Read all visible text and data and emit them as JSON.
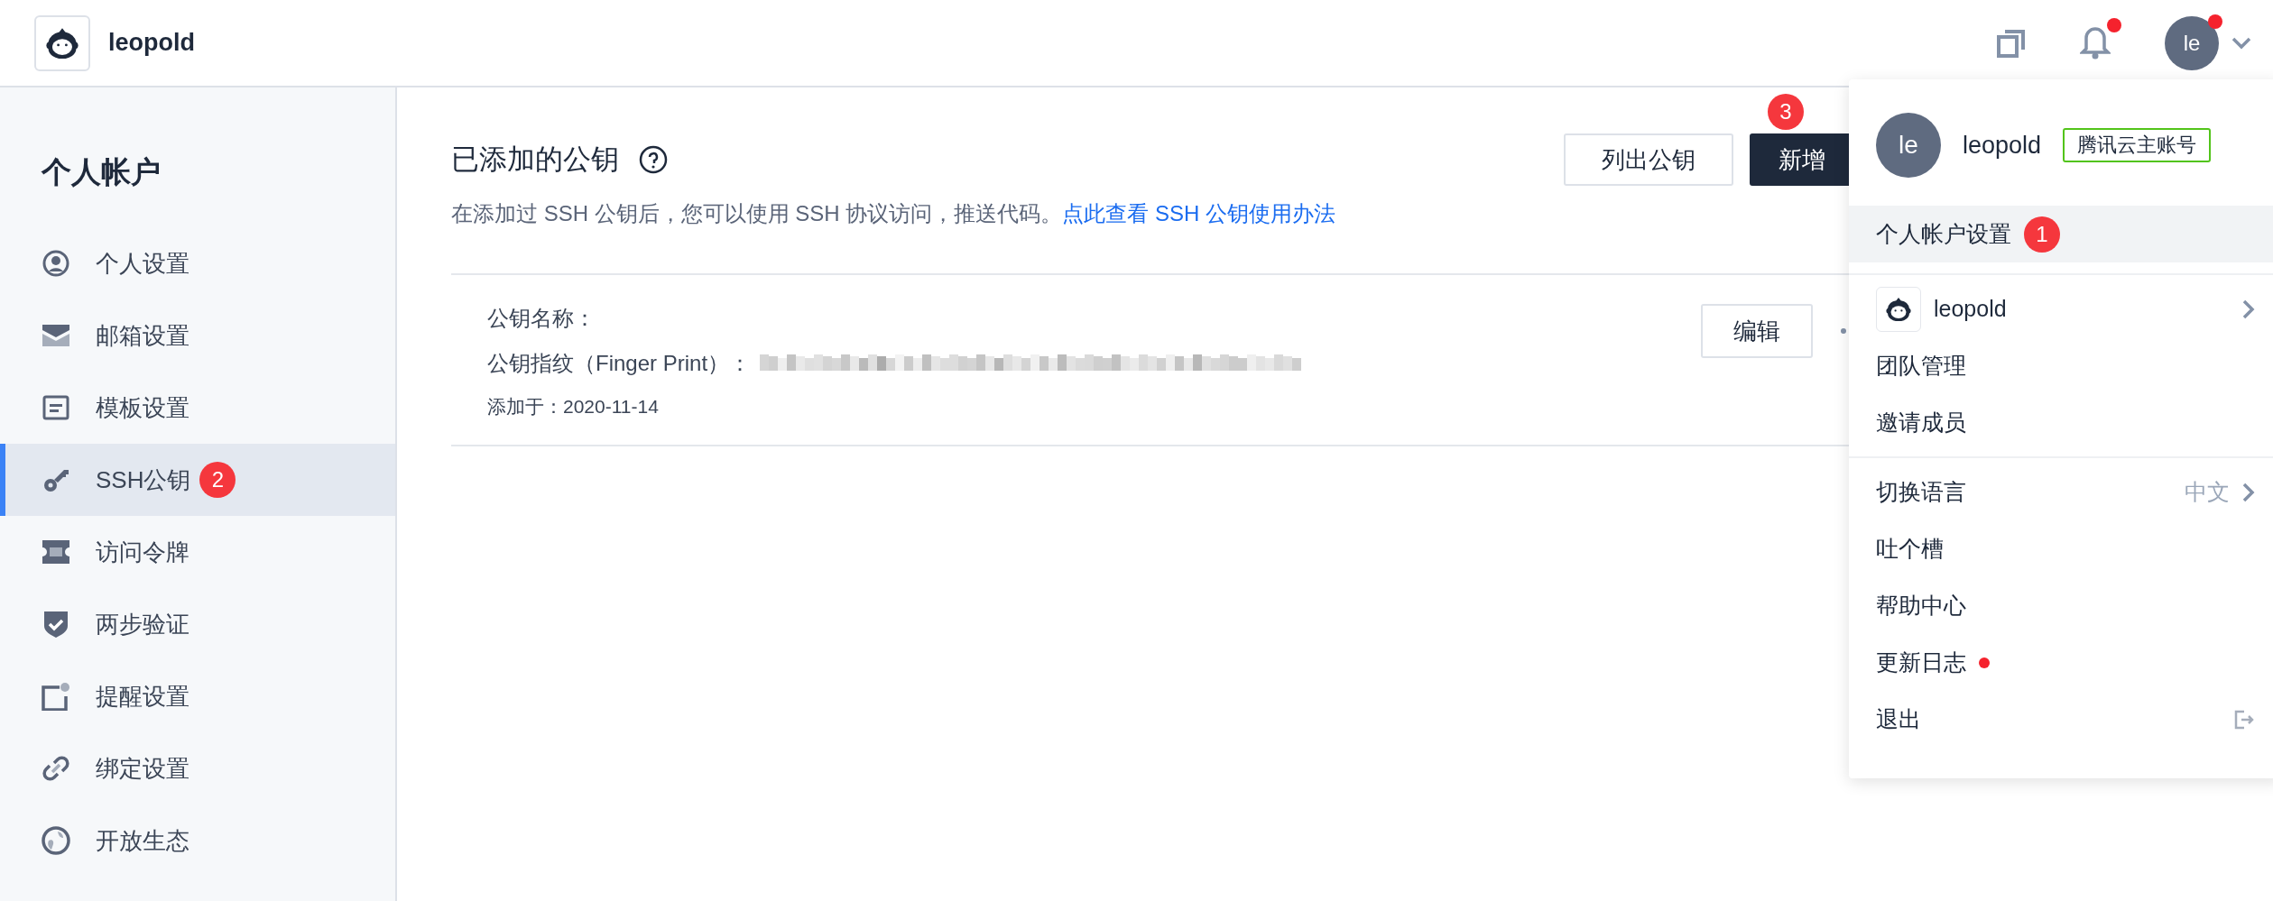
{
  "header": {
    "brand": "leopold",
    "icons": [
      {
        "kind": "copy",
        "dot": false
      },
      {
        "kind": "bell",
        "dot": true
      }
    ],
    "avatar": {
      "initials": "le",
      "dot": true
    }
  },
  "sidebar": {
    "title": "个人帐户",
    "items": [
      {
        "label": "个人设置",
        "selected": false
      },
      {
        "label": "邮箱设置",
        "selected": false
      },
      {
        "label": "模板设置",
        "selected": false
      },
      {
        "label": "SSH公钥",
        "selected": true,
        "badge": "2"
      },
      {
        "label": "访问令牌",
        "selected": false
      },
      {
        "label": "两步验证",
        "selected": false
      },
      {
        "label": "提醒设置",
        "selected": false
      },
      {
        "label": "绑定设置",
        "selected": false
      },
      {
        "label": "开放生态",
        "selected": false
      }
    ]
  },
  "main": {
    "title": "已添加的公钥",
    "description": "在添加过 SSH 公钥后，您可以使用 SSH 协议访问，推送代码。",
    "link": "点此查看 SSH 公钥使用办法",
    "buttons": [
      {
        "label": "列出公钥",
        "kind": "outline"
      },
      {
        "label": "新增",
        "kind": "primary",
        "badge": "3"
      }
    ],
    "keys": [
      {
        "name_label": "公钥名称：",
        "fingerprint_label": "公钥指纹（Finger Print）：",
        "added": "添加于：2020-11-14",
        "edit": "编辑"
      }
    ]
  },
  "menu": {
    "user": {
      "initials": "le",
      "name": "leopold",
      "tag": "腾讯云主账号"
    },
    "sections": [
      [
        {
          "kind": "plain",
          "label": "个人帐户设置",
          "selected": true,
          "badge": "1"
        }
      ],
      [
        {
          "kind": "team",
          "label": "leopold",
          "selected": false
        },
        {
          "kind": "plain",
          "label": "团队管理",
          "selected": false
        },
        {
          "kind": "plain",
          "label": "邀请成员",
          "selected": false
        }
      ],
      [
        {
          "kind": "submenu",
          "label": "切换语言",
          "value": "中文",
          "selected": false
        },
        {
          "kind": "plain",
          "label": "吐个槽",
          "selected": false
        },
        {
          "kind": "plain",
          "label": "帮助中心",
          "selected": false
        },
        {
          "kind": "dot",
          "label": "更新日志",
          "selected": false
        },
        {
          "kind": "logout",
          "label": "退出",
          "selected": false
        }
      ]
    ]
  }
}
